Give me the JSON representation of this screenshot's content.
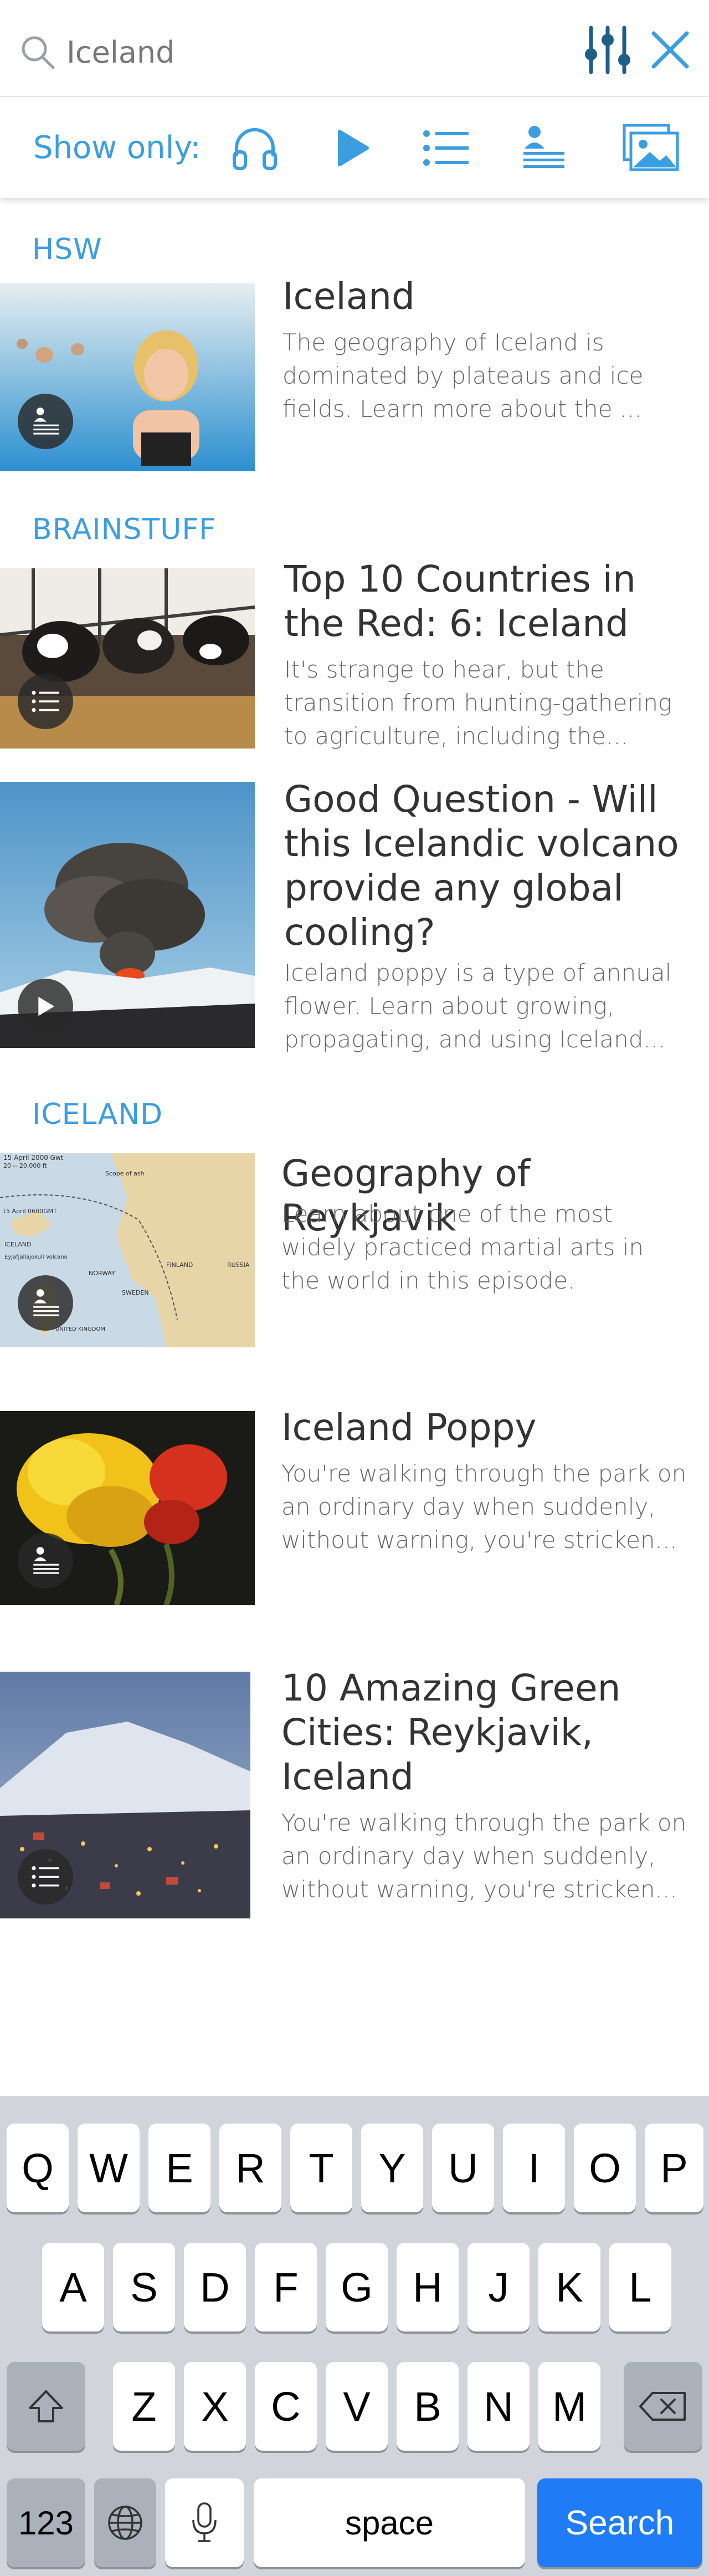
{
  "search": {
    "query": "Iceland"
  },
  "filter": {
    "show_only_label": "Show only:"
  },
  "sections": [
    {
      "label": "HSW"
    },
    {
      "label": "BRAINSTUFF"
    },
    {
      "label": "ICELAND"
    }
  ],
  "results": [
    {
      "title": "Iceland",
      "description": "The geography of Iceland is dominated by plateaus and ice fields. Learn more about the ...",
      "media_type": "article-icon"
    },
    {
      "title": "Top 10 Countries in the Red: 6: Iceland",
      "description": "It's strange to hear, but the transition from hunting-gathering to agriculture, including the...",
      "media_type": "list-icon"
    },
    {
      "title": "Good Question - Will this Icelandic volcano provide any global cooling?",
      "description": "Iceland poppy is a type of annual flower. Learn about growing, propagating, and using Iceland...",
      "media_type": "play-icon"
    },
    {
      "title": "Geography of Reykjavik",
      "description": "Learn about one of the most widely practiced martial arts in the world in this episode.",
      "media_type": "article-icon"
    },
    {
      "title": "Iceland Poppy",
      "description": "You're walking through the park on an ordinary day when suddenly, without warning, you're stricken...",
      "media_type": "article-icon"
    },
    {
      "title": "10 Amazing Green Cities: Reykjavik, Iceland",
      "description": "You're walking through the park on an ordinary day when suddenly, without warning, you're stricken...",
      "media_type": "list-icon"
    }
  ],
  "map_labels": {
    "top": "15 April 2000 Gwt",
    "range": "20 -- 20,000 ft",
    "plume": "Scope of ash",
    "date": "15 April 0600GMT",
    "iceland": "ICELAND",
    "volcano": "Eyjafjallajokull Volcano",
    "norway": "NORWAY",
    "sweden": "SWEDEN",
    "finland": "FINLAND",
    "russia": "RUSSIA",
    "uk": "UNITED KINGDOM"
  },
  "keyboard": {
    "row1": [
      "Q",
      "W",
      "E",
      "R",
      "T",
      "Y",
      "U",
      "I",
      "O",
      "P"
    ],
    "row2": [
      "A",
      "S",
      "D",
      "F",
      "G",
      "H",
      "J",
      "K",
      "L"
    ],
    "row3": [
      "Z",
      "X",
      "C",
      "V",
      "B",
      "N",
      "M"
    ],
    "numbers_label": "123",
    "space_label": "space",
    "search_label": "Search"
  }
}
